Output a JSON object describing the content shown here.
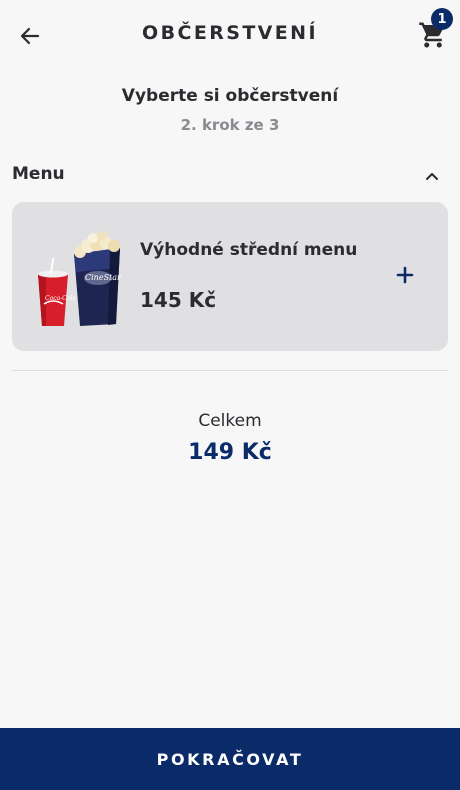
{
  "header": {
    "title": "OBČERSTVENÍ",
    "back_icon": "arrow-left-icon",
    "cart_icon": "shopping-cart-icon",
    "cart_count": "1"
  },
  "step": {
    "title": "Vyberte si občerstvení",
    "subtitle": "2. krok ze 3"
  },
  "section": {
    "title": "Menu",
    "toggle_icon": "chevron-up-icon"
  },
  "products": [
    {
      "name": "Výhodné střední menu",
      "price": "145 Kč",
      "image": "popcorn-and-drink-image",
      "add_icon": "plus-icon"
    }
  ],
  "total": {
    "label": "Celkem",
    "value": "149 Kč"
  },
  "footer": {
    "continue_label": "POKRAČOVAT"
  },
  "colors": {
    "primary": "#0b2a68",
    "background": "#f7f7f8",
    "card": "#e0e0e3"
  }
}
